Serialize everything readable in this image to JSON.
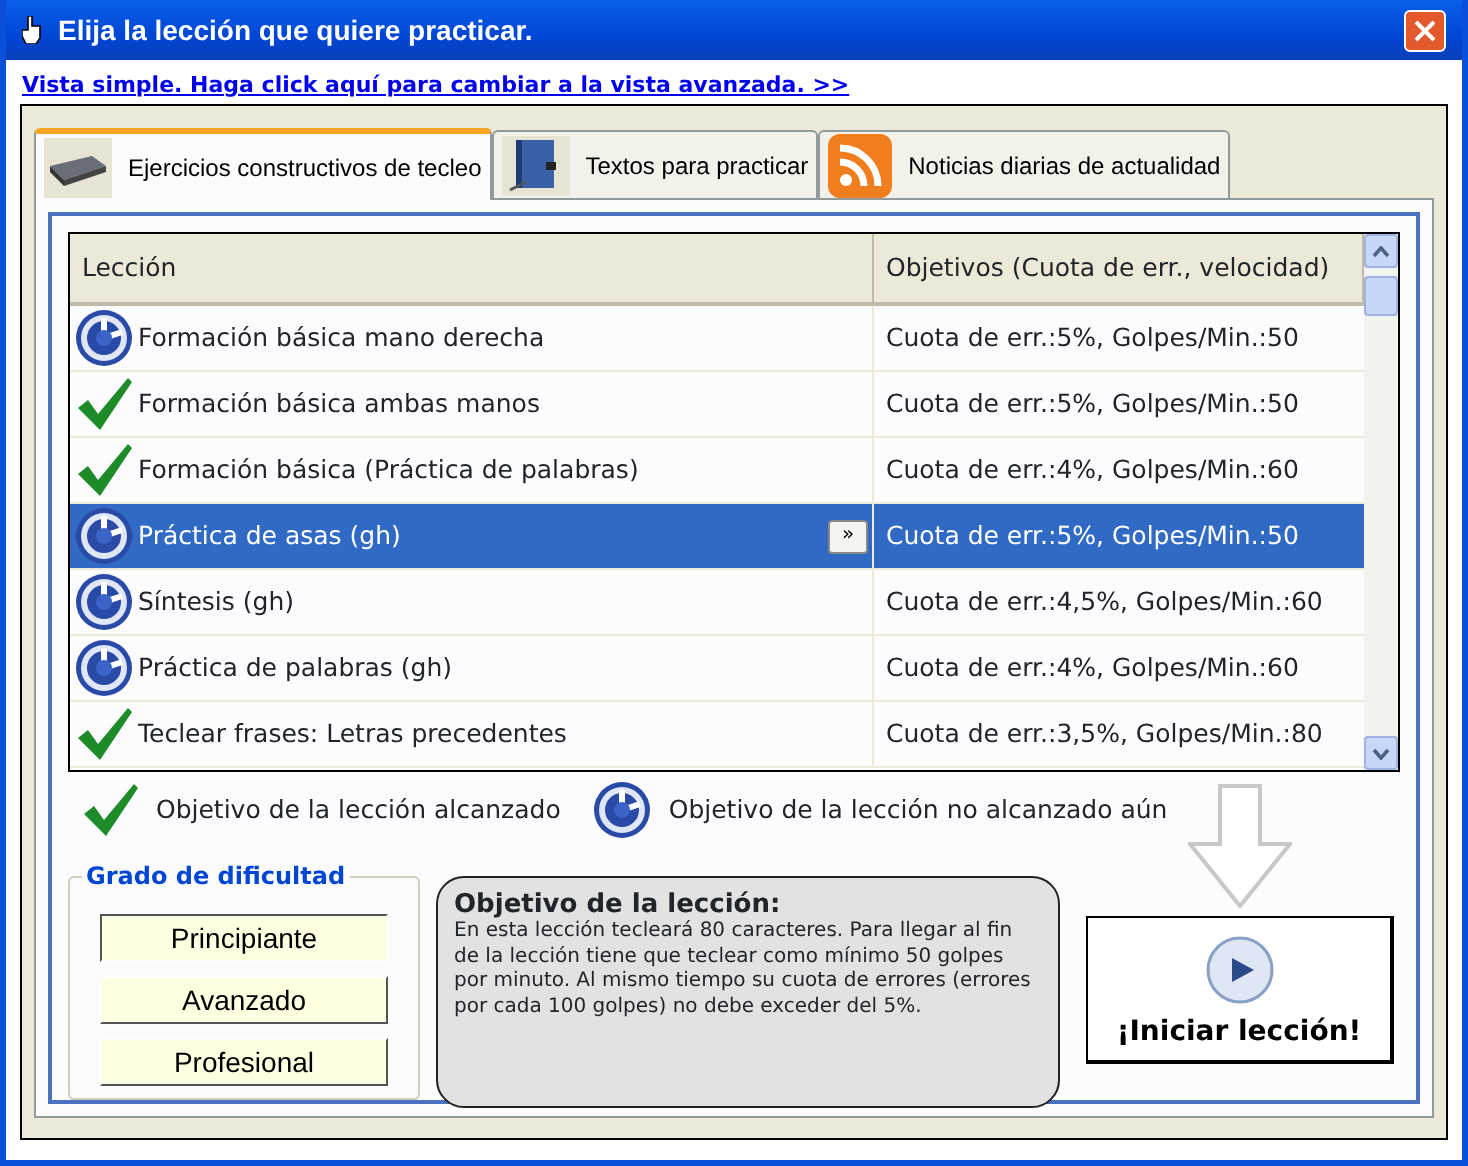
{
  "window": {
    "title": "Elija la lección que quiere practicar."
  },
  "view_link": "Vista simple. Haga click aquí para cambiar a la vista avanzada. >>",
  "tabs": [
    {
      "label": "Ejercicios constructivos de tecleo",
      "selected": true
    },
    {
      "label": "Textos para practicar",
      "selected": false
    },
    {
      "label": "Noticias diarias de actualidad",
      "selected": false
    }
  ],
  "table": {
    "columns": [
      "Lección",
      "Objetivos (Cuota de err., velocidad)"
    ],
    "rows": [
      {
        "lesson": "Formación básica mano derecha",
        "goal": "Cuota de err.:5%, Golpes/Min.:50",
        "goal_reached": false,
        "selected": false
      },
      {
        "lesson": "Formación básica ambas manos",
        "goal": "Cuota de err.:5%, Golpes/Min.:50",
        "goal_reached": true,
        "selected": false
      },
      {
        "lesson": "Formación básica (Práctica de palabras)",
        "goal": "Cuota de err.:4%, Golpes/Min.:60",
        "goal_reached": true,
        "selected": false
      },
      {
        "lesson": "Práctica de asas (gh)",
        "goal": "Cuota de err.:5%, Golpes/Min.:50",
        "goal_reached": false,
        "selected": true,
        "more_button": "»"
      },
      {
        "lesson": "Síntesis (gh)",
        "goal": "Cuota de err.:4,5%, Golpes/Min.:60",
        "goal_reached": false,
        "selected": false
      },
      {
        "lesson": "Práctica de palabras (gh)",
        "goal": "Cuota de err.:4%, Golpes/Min.:60",
        "goal_reached": false,
        "selected": false
      },
      {
        "lesson": "Teclear frases: Letras precedentes",
        "goal": "Cuota de err.:3,5%, Golpes/Min.:80",
        "goal_reached": true,
        "selected": false
      }
    ]
  },
  "legend": [
    {
      "goal_reached": true,
      "label": "Objetivo de la lección alcanzado"
    },
    {
      "goal_reached": false,
      "label": "Objetivo de la lección no alcanzado aún"
    }
  ],
  "difficulty": {
    "title": "Grado de dificultad",
    "options": [
      {
        "label": "Principiante",
        "selected": true
      },
      {
        "label": "Avanzado",
        "selected": false
      },
      {
        "label": "Profesional",
        "selected": false
      }
    ]
  },
  "lesson_goal": {
    "title": "Objetivo de la lección:",
    "text": "En esta lección tecleará 80 caracteres. Para llegar al fin de la lección tiene que teclear como mínimo 50 golpes por minuto. Al mismo tiempo su cuota de errores (errores por cada 100 golpes) no debe exceder del 5%."
  },
  "start_button": "¡Iniciar lección!"
}
